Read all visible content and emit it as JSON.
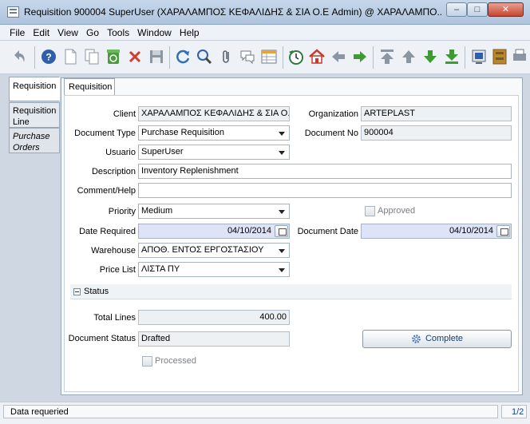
{
  "window": {
    "title": "Requisition  900004  SuperUser (ΧΑΡΑΛΑΜΠΟΣ ΚΕΦΑΛΙΔΗΣ & ΣΙΑ Ο.Ε Admin) @ ΧΑΡΑΛΑΜΠΟ...",
    "min_glyph": "–",
    "max_glyph": "□",
    "close_glyph": "✕"
  },
  "menu": [
    "File",
    "Edit",
    "View",
    "Go",
    "Tools",
    "Window",
    "Help"
  ],
  "left_tabs": [
    {
      "label": "Requisition"
    },
    {
      "label": "Requisition Line"
    },
    {
      "label": "Purchase Orders"
    }
  ],
  "header_tab": "Requisition",
  "form": {
    "client": {
      "label": "Client",
      "value": "ΧΑΡΑΛΑΜΠΟΣ ΚΕΦΑΛΙΔΗΣ & ΣΙΑ Ο.Ε"
    },
    "organization": {
      "label": "Organization",
      "value": "ARTEPLAST"
    },
    "document_type": {
      "label": "Document Type",
      "value": "Purchase Requisition"
    },
    "document_no": {
      "label": "Document No",
      "value": "900004"
    },
    "usuario": {
      "label": "Usuario",
      "value": "SuperUser"
    },
    "description": {
      "label": "Description",
      "value": "Inventory Replenishment"
    },
    "comment_help": {
      "label": "Comment/Help",
      "value": ""
    },
    "priority": {
      "label": "Priority",
      "value": "Medium"
    },
    "approved": {
      "label": "Approved"
    },
    "date_required": {
      "label": "Date Required",
      "value": "04/10/2014"
    },
    "document_date": {
      "label": "Document Date",
      "value": "04/10/2014"
    },
    "warehouse": {
      "label": "Warehouse",
      "value": "ΑΠΟΘ. ΕΝΤΟΣ ΕΡΓΟΣΤΑΣΙΟΥ"
    },
    "price_list": {
      "label": "Price List",
      "value": "ΛΙΣΤΑ ΠΥ"
    }
  },
  "status_section": {
    "title": "Status",
    "total_lines": {
      "label": "Total Lines",
      "value": "400.00"
    },
    "document_status": {
      "label": "Document Status",
      "value": "Drafted"
    },
    "complete_button": "Complete",
    "processed": {
      "label": "Processed"
    }
  },
  "statusbar": {
    "message": "Data requeried",
    "page": "1/2"
  }
}
